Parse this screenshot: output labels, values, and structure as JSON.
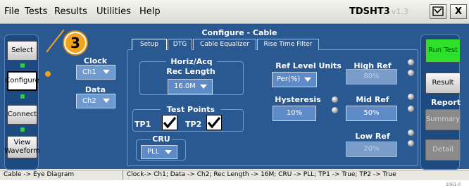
{
  "menu": {
    "file": "File",
    "tests": "Tests",
    "results": "Results",
    "utilities": "Utilities",
    "help": "Help",
    "app_title": "TDSHT3",
    "app_version": "v1.3",
    "minimize": "",
    "close": "X"
  },
  "sidebar": {
    "select": "Select",
    "configure": "Configure",
    "connect": "Connect",
    "view_waveform": "View Waveform"
  },
  "callout": "3",
  "source": {
    "clock_label": "Clock",
    "clock_value": "Ch1",
    "data_label": "Data",
    "data_value": "Ch2"
  },
  "panel_title": "Configure - Cable",
  "tabs": [
    "Setup",
    "DTG",
    "Cable Equalizer",
    "Rise Time Filter"
  ],
  "setup": {
    "horiz_acq_label": "Horiz/Acq",
    "rec_length_label": "Rec Length",
    "rec_length_value": "16.0M",
    "test_points_label": "Test Points",
    "tp1_label": "TP1",
    "tp1_checked": true,
    "tp2_label": "TP2",
    "tp2_checked": true,
    "cru_label": "CRU",
    "cru_value": "PLL"
  },
  "ref_levels": {
    "units_label": "Ref Level Units",
    "units_value": "Per(%)",
    "hysteresis_label": "Hysteresis",
    "hysteresis_value": "10%",
    "high_ref_label": "High Ref",
    "high_ref_value": "80%",
    "mid_ref_label": "Mid Ref",
    "mid_ref_value": "50%",
    "low_ref_label": "Low Ref",
    "low_ref_value": "20%"
  },
  "right": {
    "run_test": "Run Test",
    "result": "Result",
    "report_label": "Report",
    "summary": "Summary",
    "detail": "Detail"
  },
  "status": {
    "left": "Cable -> Eye Diagram",
    "right": "Clock-> Ch1; Data -> Ch2; Rec Length -> 16M; CRU -> PLL; TP1 -> True; TP2 -> True"
  },
  "figure_number": "1061-0"
}
